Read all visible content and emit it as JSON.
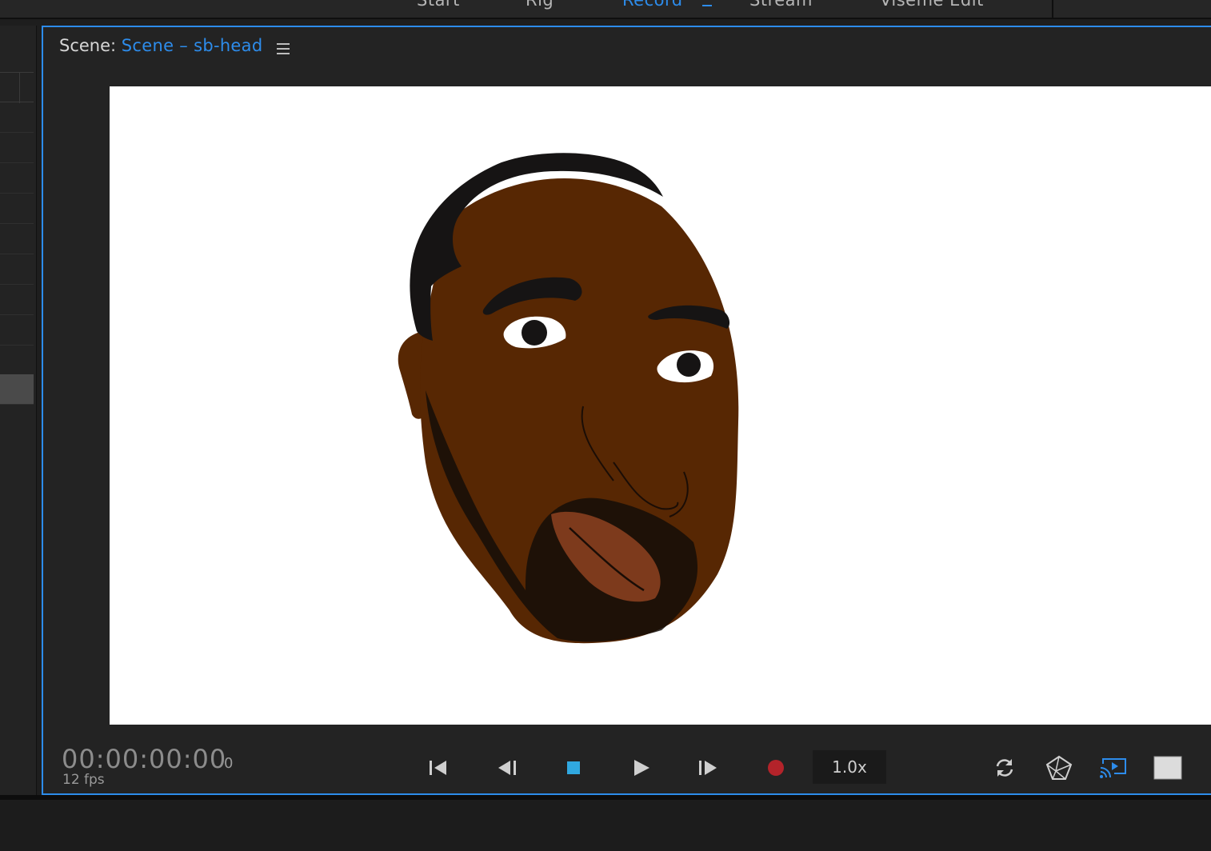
{
  "workspace_tabs": [
    {
      "label": "Start",
      "active": false
    },
    {
      "label": "Rig",
      "active": false
    },
    {
      "label": "Record",
      "active": true
    },
    {
      "label": "Stream",
      "active": false
    },
    {
      "label": "Viseme Edit",
      "active": false
    }
  ],
  "scene": {
    "prefix": "Scene:",
    "name": "Scene – sb-head",
    "menu_icon": "hamburger-icon"
  },
  "transport": {
    "timecode": "00:00:00:00",
    "frame": "0",
    "fps": "12 fps",
    "speed": "1.0x",
    "buttons": [
      {
        "name": "go-to-start-button",
        "icon": "skip-to-start-icon"
      },
      {
        "name": "step-back-button",
        "icon": "step-backward-icon"
      },
      {
        "name": "stop-button",
        "icon": "stop-icon"
      },
      {
        "name": "play-button",
        "icon": "play-icon"
      },
      {
        "name": "step-forward-button",
        "icon": "step-forward-icon"
      },
      {
        "name": "record-button",
        "icon": "record-icon"
      },
      {
        "name": "refresh-button",
        "icon": "refresh-icon"
      },
      {
        "name": "calibrate-button",
        "icon": "polyhedron-icon"
      },
      {
        "name": "cast-button",
        "icon": "cast-screen-icon"
      },
      {
        "name": "background-toggle",
        "icon": "square-swatch-icon"
      }
    ]
  },
  "colors": {
    "accent": "#2d8ceb",
    "record": "#b3232a",
    "stop": "#30a8e0",
    "skin": "#572703",
    "hair": "#161414",
    "lips": "#7d3a1c"
  }
}
